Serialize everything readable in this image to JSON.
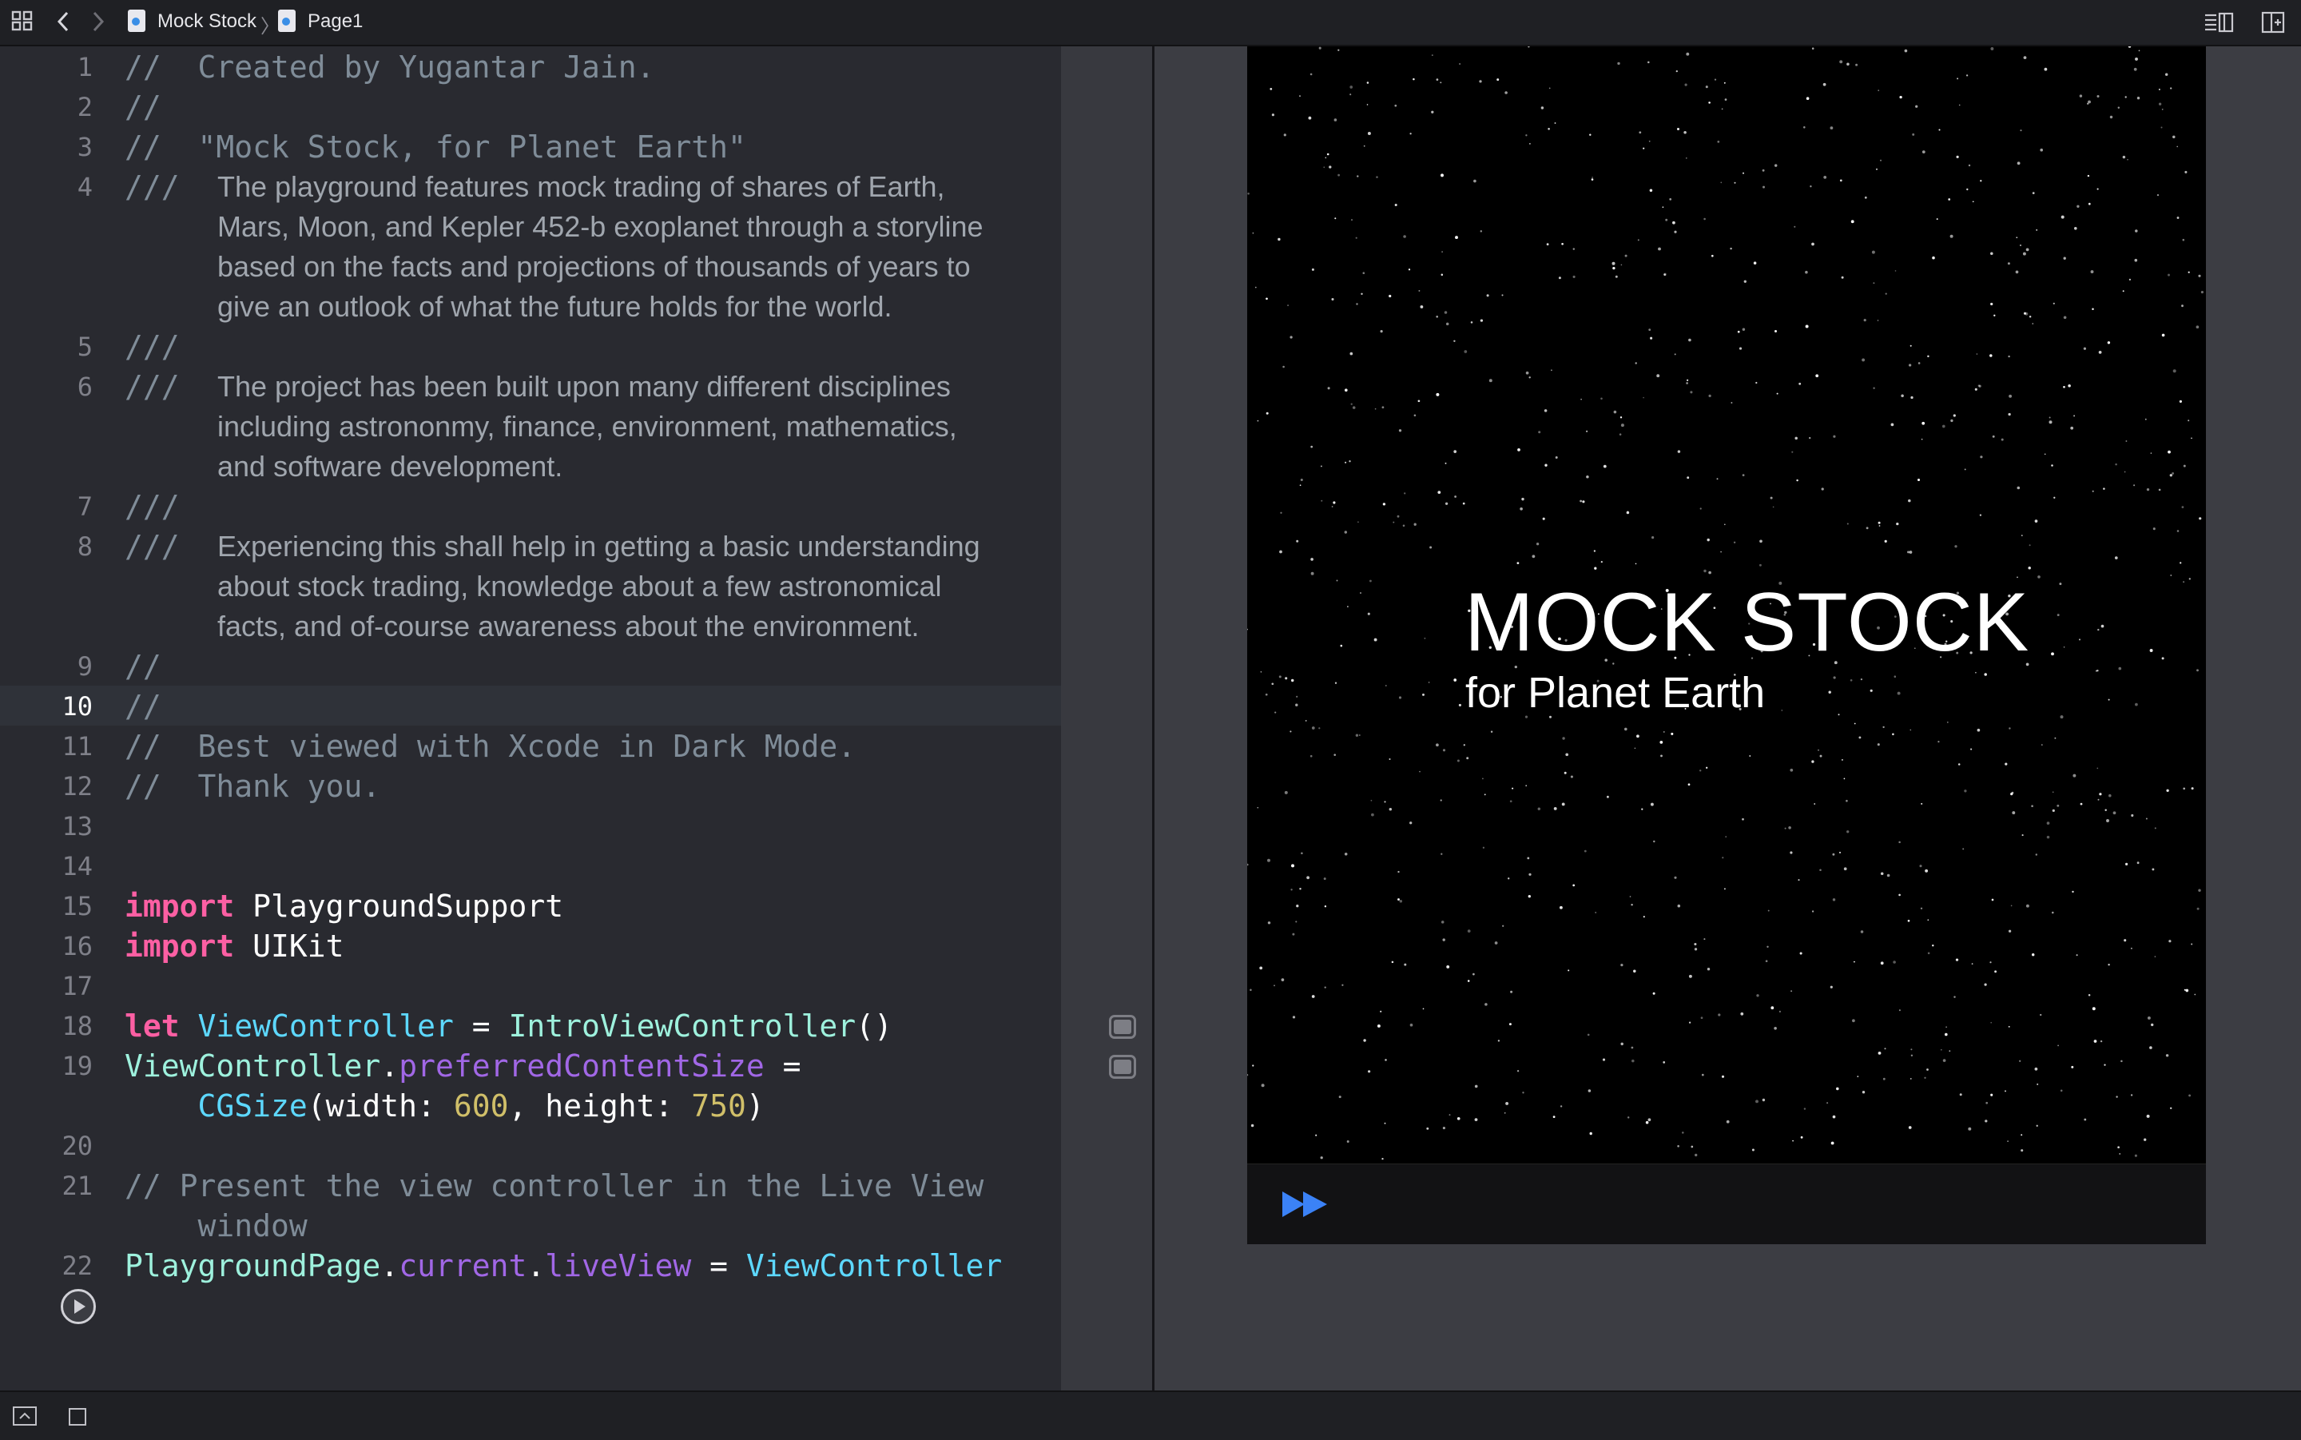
{
  "breadcrumb": {
    "project": "Mock Stock",
    "page": "Page1"
  },
  "icons": {
    "grid": "grid-icon",
    "back": "chevron-left-icon",
    "forward": "chevron-right-icon",
    "inspector": "inspector-icon",
    "split": "split-view-icon",
    "play": "play-icon",
    "fast_forward": "fast-forward-icon",
    "console": "console-icon",
    "square": "square-icon"
  },
  "editor": {
    "lines": [
      {
        "n": "1",
        "c": "//  Created by Yugantar Jain."
      },
      {
        "n": "2",
        "c": "//"
      },
      {
        "n": "3",
        "c": "//  \"Mock Stock, for Planet Earth\""
      },
      {
        "n": "4",
        "c": "///",
        "doc": [
          "The playground features mock trading of shares of Earth,",
          "Mars, Moon, and Kepler 452-b exoplanet through a storyline",
          "based on the facts and projections of thousands of years to",
          "give an outlook of what the future holds for the world."
        ]
      },
      {
        "n": "5",
        "c": "///"
      },
      {
        "n": "6",
        "c": "///",
        "doc": [
          "The project has been built upon many different disciplines",
          "including astrononmy, finance, environment, mathematics,",
          "and software development."
        ]
      },
      {
        "n": "7",
        "c": "///"
      },
      {
        "n": "8",
        "c": "///",
        "doc": [
          "Experiencing this shall help in getting a basic understanding",
          "about stock trading, knowledge about a few astronomical",
          "facts, and of-course awareness about the environment."
        ]
      },
      {
        "n": "9",
        "c": "//"
      },
      {
        "n": "10",
        "c": "//"
      },
      {
        "n": "11",
        "c": "//  Best viewed with Xcode in Dark Mode."
      },
      {
        "n": "12",
        "c": "//  Thank you."
      },
      {
        "n": "13",
        "c": ""
      },
      {
        "n": "14",
        "c": ""
      },
      {
        "n": "15",
        "tokens": [
          [
            "kw",
            "import"
          ],
          [
            "plain",
            " PlaygroundSupport"
          ]
        ]
      },
      {
        "n": "16",
        "tokens": [
          [
            "kw",
            "import"
          ],
          [
            "plain",
            " UIKit"
          ]
        ]
      },
      {
        "n": "17",
        "c": ""
      },
      {
        "n": "18",
        "tokens": [
          [
            "kw",
            "let"
          ],
          [
            "plain",
            " "
          ],
          [
            "ty",
            "ViewController"
          ],
          [
            "plain",
            " = "
          ],
          [
            "cls",
            "IntroViewController"
          ],
          [
            "plain",
            "()"
          ]
        ]
      },
      {
        "n": "19",
        "tokens": [
          [
            "cls",
            "ViewController"
          ],
          [
            "plain",
            "."
          ],
          [
            "prop",
            "preferredContentSize"
          ],
          [
            "plain",
            " ="
          ]
        ],
        "cont": [
          [
            "plain",
            "    "
          ],
          [
            "ty",
            "CGSize"
          ],
          [
            "plain",
            "(width: "
          ],
          [
            "num",
            "600"
          ],
          [
            "plain",
            ", height: "
          ],
          [
            "num",
            "750"
          ],
          [
            "plain",
            ")"
          ]
        ]
      },
      {
        "n": "20",
        "c": ""
      },
      {
        "n": "21",
        "c": "// Present the view controller in the Live View",
        "contc": "    window"
      },
      {
        "n": "22",
        "tokens": [
          [
            "cls",
            "PlaygroundPage"
          ],
          [
            "plain",
            "."
          ],
          [
            "prop",
            "current"
          ],
          [
            "plain",
            "."
          ],
          [
            "prop",
            "liveView"
          ],
          [
            "plain",
            " = "
          ],
          [
            "ty",
            "ViewController"
          ]
        ]
      }
    ]
  },
  "live_view": {
    "title": "MOCK STOCK",
    "subtitle": "for Planet Earth"
  }
}
